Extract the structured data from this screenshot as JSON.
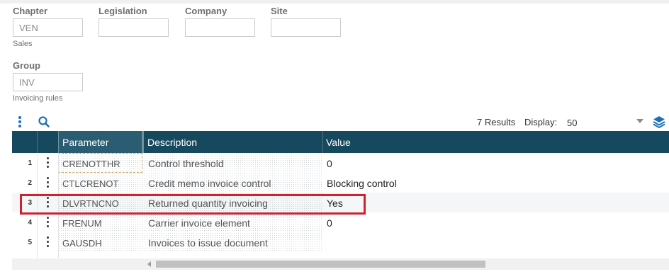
{
  "fields": [
    {
      "label": "Chapter",
      "value": "VEN",
      "sub": "Sales"
    },
    {
      "label": "Legislation",
      "value": "",
      "sub": ""
    },
    {
      "label": "Company",
      "value": "",
      "sub": ""
    },
    {
      "label": "Site",
      "value": "",
      "sub": ""
    },
    {
      "label": "Group",
      "value": "INV",
      "sub": "Invoicing rules"
    }
  ],
  "toolbar": {
    "results": "7 Results",
    "display_label": "Display:",
    "display_value": "50",
    "icons": [
      "more-vertical-icon",
      "search-icon",
      "layers-icon"
    ]
  },
  "grid": {
    "headers": [
      "Parameter",
      "Description",
      "Value"
    ],
    "rows": [
      {
        "num": "1",
        "param": "CRENOTTHR",
        "desc": "Control threshold",
        "value": "0"
      },
      {
        "num": "2",
        "param": "CTLCRENOT",
        "desc": "Credit memo invoice control",
        "value": "Blocking control"
      },
      {
        "num": "3",
        "param": "DLVRTNCNO",
        "desc": "Returned quantity invoicing",
        "value": "Yes"
      },
      {
        "num": "4",
        "param": "FRENUM",
        "desc": "Carrier invoice element",
        "value": "0"
      },
      {
        "num": "5",
        "param": "GAUSDH",
        "desc": "Invoices to issue document",
        "value": ""
      }
    ]
  },
  "colors": {
    "header_bg": "#17495e",
    "accent": "#1d6fb8",
    "highlight": "#d1202f"
  }
}
